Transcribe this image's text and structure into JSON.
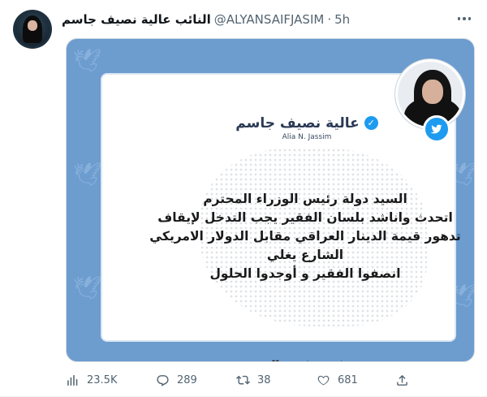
{
  "tweet": {
    "display_name": "النائب عالية نصيف جاسم",
    "handle": "@ALYANSAIFJASIM",
    "separator": "·",
    "time": "5h"
  },
  "image": {
    "brand_arabic": "عالية نصيف جاسم",
    "brand_latin": "Alia N. Jassim",
    "lines": [
      "السيد دولة رئيس الوزراء المحترم",
      "اتحدث واناشد بلسان الفقير يجب التدخل لإيقاف",
      "تدهور قيمة الدينار العراقي مقابل الدولار الامريكي",
      "الشارع يغلي",
      "انصفوا الفقير و أوجدوا الحلول"
    ],
    "card_action_icons": [
      "reply-arrow-icon",
      "heart-icon",
      "star-icon",
      "retweet-icon",
      "forward-arrow-icon"
    ]
  },
  "stats": {
    "views": "23.5K",
    "replies": "289",
    "retweets": "38",
    "likes": "681"
  },
  "colors": {
    "media_background": "#6d9ccf",
    "twitter_blue": "#1d9bf0",
    "secondary_text": "#536471"
  }
}
